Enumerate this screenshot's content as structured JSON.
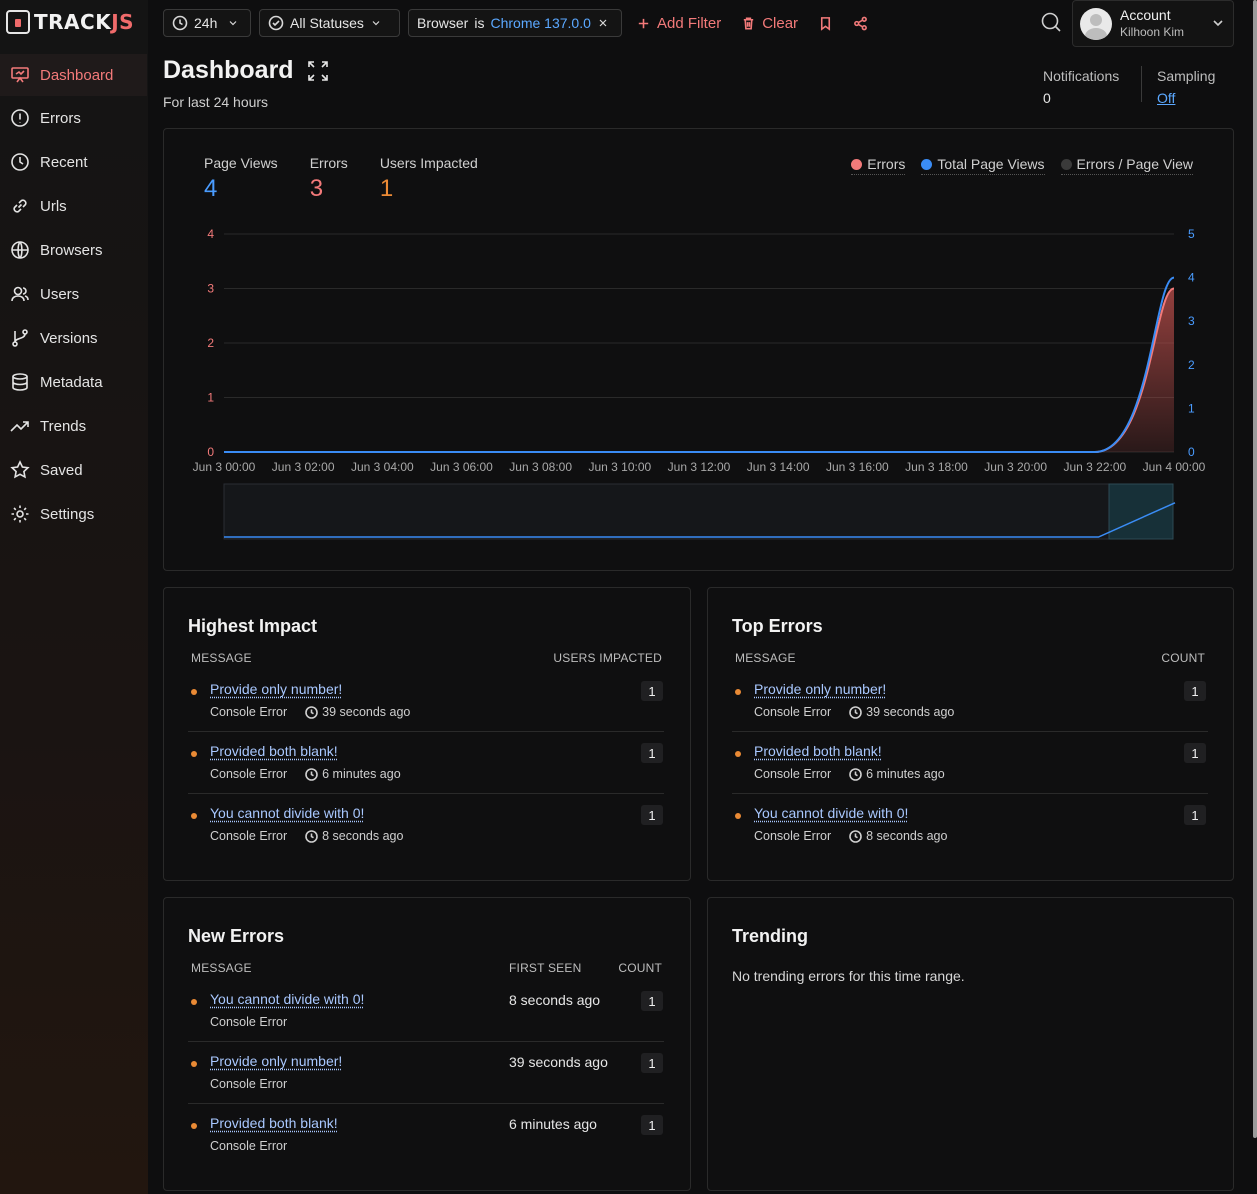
{
  "app": {
    "logo_main": "TRACK",
    "logo_accent": "JS"
  },
  "sidebar": {
    "items": [
      {
        "label": "Dashboard",
        "icon": "dashboard-icon",
        "active": true
      },
      {
        "label": "Errors",
        "icon": "alert-circle-icon"
      },
      {
        "label": "Recent",
        "icon": "clock-icon"
      },
      {
        "label": "Urls",
        "icon": "link-icon"
      },
      {
        "label": "Browsers",
        "icon": "globe-icon"
      },
      {
        "label": "Users",
        "icon": "users-icon"
      },
      {
        "label": "Versions",
        "icon": "branch-icon"
      },
      {
        "label": "Metadata",
        "icon": "database-icon"
      },
      {
        "label": "Trends",
        "icon": "trend-icon"
      },
      {
        "label": "Saved",
        "icon": "star-icon"
      },
      {
        "label": "Settings",
        "icon": "gear-icon"
      }
    ]
  },
  "toolbar": {
    "time_range": "24h",
    "status": "All Statuses",
    "filter_field": "Browser",
    "filter_op": "is",
    "filter_value": "Chrome 137.0.0",
    "add_filter": "Add Filter",
    "clear": "Clear"
  },
  "account": {
    "title": "Account",
    "name": "Kilhoon Kim"
  },
  "page": {
    "title": "Dashboard",
    "subtitle": "For last 24 hours"
  },
  "meta": {
    "notifications_label": "Notifications",
    "notifications_value": "0",
    "sampling_label": "Sampling",
    "sampling_value": "Off"
  },
  "stats": [
    {
      "label": "Page Views",
      "value": "4",
      "color": "#4a9cff"
    },
    {
      "label": "Errors",
      "value": "3",
      "color": "#f37a7a"
    },
    {
      "label": "Users Impacted",
      "value": "1",
      "color": "#ec8a35"
    }
  ],
  "legend": [
    {
      "label": "Errors",
      "color": "#f37a7a"
    },
    {
      "label": "Total Page Views",
      "color": "#3a8cf5"
    },
    {
      "label": "Errors / Page View",
      "color": "#3a3a3a"
    }
  ],
  "chart_data": {
    "type": "area",
    "x": [
      "Jun 3 00:00",
      "Jun 3 02:00",
      "Jun 3 04:00",
      "Jun 3 06:00",
      "Jun 3 08:00",
      "Jun 3 10:00",
      "Jun 3 12:00",
      "Jun 3 14:00",
      "Jun 3 16:00",
      "Jun 3 18:00",
      "Jun 3 20:00",
      "Jun 3 22:00",
      "Jun 4 00:00"
    ],
    "series": [
      {
        "name": "Errors",
        "axis": "left",
        "color": "#f37a7a",
        "values": [
          0,
          0,
          0,
          0,
          0,
          0,
          0,
          0,
          0,
          0,
          0,
          0,
          3
        ]
      },
      {
        "name": "Total Page Views",
        "axis": "right",
        "color": "#3a8cf5",
        "values": [
          0,
          0,
          0,
          0,
          0,
          0,
          0,
          0,
          0,
          0,
          0,
          0,
          4
        ]
      }
    ],
    "left_ticks": [
      "0",
      "1",
      "2",
      "3",
      "4"
    ],
    "right_ticks": [
      "0",
      "1",
      "2",
      "3",
      "4",
      "5"
    ],
    "ylim_left": [
      0,
      4
    ],
    "ylim_right": [
      0,
      5
    ],
    "grid": true
  },
  "highest_impact": {
    "title": "Highest Impact",
    "col_message": "MESSAGE",
    "col_value": "USERS IMPACTED",
    "rows": [
      {
        "message": "Provide only number!",
        "type": "Console Error",
        "time": "39 seconds ago",
        "value": "1"
      },
      {
        "message": "Provided both blank!",
        "type": "Console Error",
        "time": "6 minutes ago",
        "value": "1"
      },
      {
        "message": "You cannot divide with 0!",
        "type": "Console Error",
        "time": "8 seconds ago",
        "value": "1"
      }
    ]
  },
  "top_errors": {
    "title": "Top Errors",
    "col_message": "MESSAGE",
    "col_value": "COUNT",
    "rows": [
      {
        "message": "Provide only number!",
        "type": "Console Error",
        "time": "39 seconds ago",
        "value": "1"
      },
      {
        "message": "Provided both blank!",
        "type": "Console Error",
        "time": "6 minutes ago",
        "value": "1"
      },
      {
        "message": "You cannot divide with 0!",
        "type": "Console Error",
        "time": "8 seconds ago",
        "value": "1"
      }
    ]
  },
  "new_errors": {
    "title": "New Errors",
    "col_message": "MESSAGE",
    "col_first_seen": "FIRST SEEN",
    "col_count": "COUNT",
    "rows": [
      {
        "message": "You cannot divide with 0!",
        "type": "Console Error",
        "first_seen": "8 seconds ago",
        "count": "1"
      },
      {
        "message": "Provide only number!",
        "type": "Console Error",
        "first_seen": "39 seconds ago",
        "count": "1"
      },
      {
        "message": "Provided both blank!",
        "type": "Console Error",
        "first_seen": "6 minutes ago",
        "count": "1"
      }
    ]
  },
  "trending": {
    "title": "Trending",
    "empty": "No trending errors for this time range."
  }
}
